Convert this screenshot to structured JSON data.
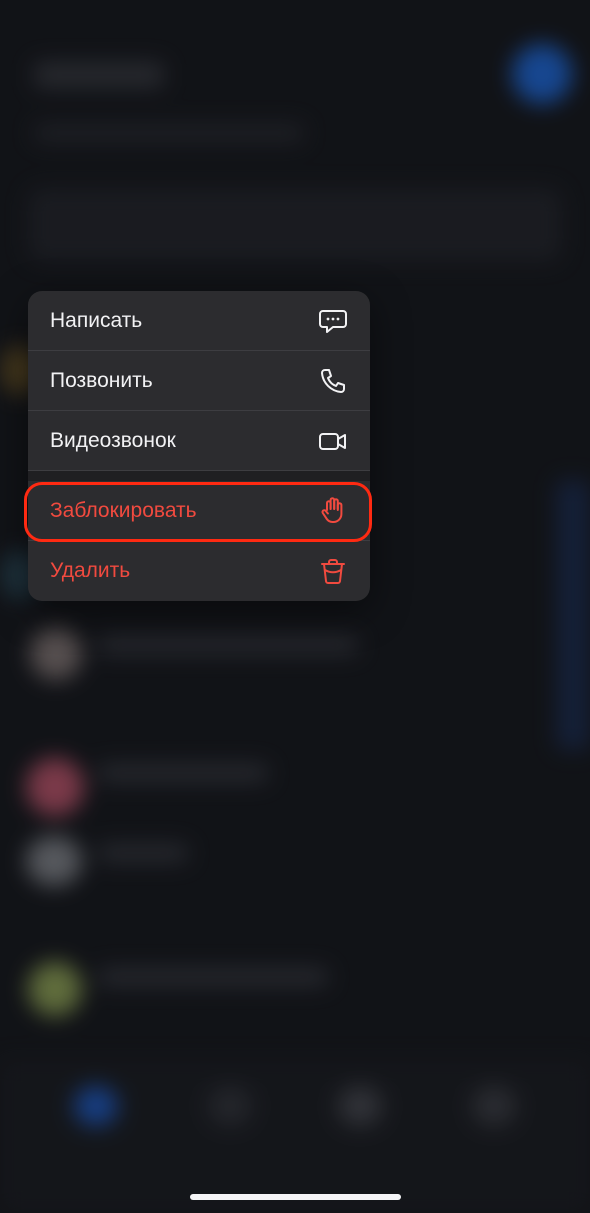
{
  "menu": {
    "items": [
      {
        "label": "Написать",
        "icon": "message-icon",
        "danger": false
      },
      {
        "label": "Позвонить",
        "icon": "phone-icon",
        "danger": false
      },
      {
        "label": "Видеозвонок",
        "icon": "video-icon",
        "danger": false
      }
    ],
    "danger_items": [
      {
        "label": "Заблокировать",
        "icon": "hand-icon",
        "danger": true
      },
      {
        "label": "Удалить",
        "icon": "trash-icon",
        "danger": true
      }
    ]
  },
  "colors": {
    "danger": "#f14a3f",
    "highlight": "#ff2a12",
    "menu_bg": "#2c2c2f",
    "text": "#f2f2f4",
    "accent": "#1f6ee8"
  }
}
